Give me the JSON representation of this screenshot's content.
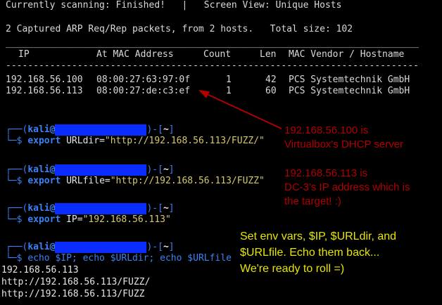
{
  "header": {
    "status": "Currently scanning: Finished!   |   Screen View: Unique Hosts",
    "summary": "2 Captured ARP Req/Rep packets, from 2 hosts.   Total size: 102",
    "divider": "___________________________________________________________________________",
    "columns": [
      "IP",
      "At MAC Address",
      "Count",
      "Len",
      "MAC Vendor / Hostname"
    ],
    "divider2": "---------------------------------------------------------------------------"
  },
  "hosts": [
    {
      "ip": "192.168.56.100",
      "mac": "08:00:27:63:97:0f",
      "count": "1",
      "len": "42",
      "vendor": "PCS Systemtechnik GmbH"
    },
    {
      "ip": "192.168.56.113",
      "mac": "08:00:27:de:c3:ef",
      "count": "1",
      "len": "60",
      "vendor": "PCS Systemtechnik GmbH"
    }
  ],
  "prompt": {
    "user": "kali",
    "at": "@",
    "path": "~",
    "open": "┌──(",
    "close": ")-[",
    "end": "]",
    "cmd_prefix": "└─$ "
  },
  "commands": [
    {
      "kw": "export",
      "rest": " URLdir=",
      "str": "\"http://192.168.56.113/FUZZ/\""
    },
    {
      "kw": "export",
      "rest": " URLfile=",
      "str": "\"http://192.168.56.113/FUZZ\""
    },
    {
      "kw": "export",
      "rest": " IP=",
      "str": "\"192.168.56.113\""
    }
  ],
  "last_command": "echo $IP; echo $URLdir; echo $URLfile",
  "output": [
    "192.168.56.113",
    "http://192.168.56.113/FUZZ/",
    "http://192.168.56.113/FUZZ"
  ],
  "annotations": {
    "red1": [
      "192.168.56.100 is",
      "Virtualbox's DHCP server"
    ],
    "red2": [
      "192.168.56.113 is",
      "DC-3's IP address which is",
      "the target! :)"
    ],
    "yellow": [
      "Set env vars, $IP, $URLdir, and",
      "$URLfile. Echo them back...",
      "We're ready to roll =)"
    ]
  },
  "colors": {
    "background": "#000000",
    "prompt_blue": "#3b82f6",
    "mask_blue": "#0a2cff",
    "annotation_red": "#b00000",
    "annotation_yellow": "#e6e600"
  }
}
